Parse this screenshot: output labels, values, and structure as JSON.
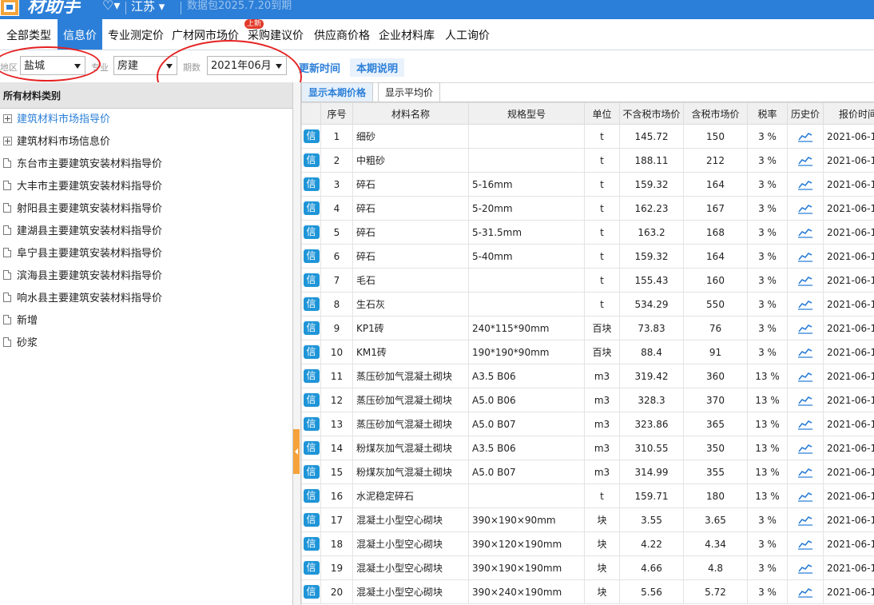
{
  "topbar": {
    "app_name": "材助手",
    "region": "江苏",
    "package_date": "数据包2025.7.20到期"
  },
  "nav": {
    "items": [
      "全部类型",
      "信息价",
      "专业测定价",
      "广材网市场价",
      "采购建议价",
      "供应商价格",
      "企业材料库",
      "人工询价"
    ],
    "active_index": 1,
    "new_badge": "上新"
  },
  "filters": {
    "area_label": "地区",
    "area_value": "盐城",
    "specialty_label": "专业",
    "specialty_value": "房建",
    "period_label": "期数",
    "period_value": "2021年06月",
    "update_time_link": "更新时间",
    "period_note_link": "本期说明"
  },
  "left_panel": {
    "header": "所有材料类别",
    "items": [
      {
        "label": "建筑材料市场指导价",
        "type": "plus",
        "highlight": true
      },
      {
        "label": "建筑材料市场信息价",
        "type": "plus",
        "highlight": false
      },
      {
        "label": "东台市主要建筑安装材料指导价",
        "type": "doc",
        "highlight": false
      },
      {
        "label": "大丰市主要建筑安装材料指导价",
        "type": "doc",
        "highlight": false
      },
      {
        "label": "射阳县主要建筑安装材料指导价",
        "type": "doc",
        "highlight": false
      },
      {
        "label": "建湖县主要建筑安装材料指导价",
        "type": "doc",
        "highlight": false
      },
      {
        "label": "阜宁县主要建筑安装材料指导价",
        "type": "doc",
        "highlight": false
      },
      {
        "label": "滨海县主要建筑安装材料指导价",
        "type": "doc",
        "highlight": false
      },
      {
        "label": "响水县主要建筑安装材料指导价",
        "type": "doc",
        "highlight": false
      },
      {
        "label": "新增",
        "type": "doc",
        "highlight": false
      },
      {
        "label": "砂浆",
        "type": "doc",
        "highlight": false
      }
    ]
  },
  "subtabs": [
    "显示本期价格",
    "显示平均价"
  ],
  "table": {
    "xin_label": "信",
    "headers": [
      "序号",
      "材料名称",
      "规格型号",
      "单位",
      "不含税市场价",
      "含税市场价",
      "税率",
      "历史价",
      "报价时间"
    ],
    "rows": [
      [
        "1",
        "细砂",
        "",
        "t",
        "145.72",
        "150",
        "3 %",
        "2021-06-1"
      ],
      [
        "2",
        "中粗砂",
        "",
        "t",
        "188.11",
        "212",
        "3 %",
        "2021-06-1"
      ],
      [
        "3",
        "碎石",
        "5-16mm",
        "t",
        "159.32",
        "164",
        "3 %",
        "2021-06-1"
      ],
      [
        "4",
        "碎石",
        "5-20mm",
        "t",
        "162.23",
        "167",
        "3 %",
        "2021-06-1"
      ],
      [
        "5",
        "碎石",
        "5-31.5mm",
        "t",
        "163.2",
        "168",
        "3 %",
        "2021-06-1"
      ],
      [
        "6",
        "碎石",
        "5-40mm",
        "t",
        "159.32",
        "164",
        "3 %",
        "2021-06-1"
      ],
      [
        "7",
        "毛石",
        "",
        "t",
        "155.43",
        "160",
        "3 %",
        "2021-06-1"
      ],
      [
        "8",
        "生石灰",
        "",
        "t",
        "534.29",
        "550",
        "3 %",
        "2021-06-1"
      ],
      [
        "9",
        "KP1砖",
        "240*115*90mm",
        "百块",
        "73.83",
        "76",
        "3 %",
        "2021-06-1"
      ],
      [
        "10",
        "KM1砖",
        "190*190*90mm",
        "百块",
        "88.4",
        "91",
        "3 %",
        "2021-06-1"
      ],
      [
        "11",
        "蒸压砂加气混凝土砌块",
        "A3.5 B06",
        "m3",
        "319.42",
        "360",
        "13 %",
        "2021-06-1"
      ],
      [
        "12",
        "蒸压砂加气混凝土砌块",
        "A5.0 B06",
        "m3",
        "328.3",
        "370",
        "13 %",
        "2021-06-1"
      ],
      [
        "13",
        "蒸压砂加气混凝土砌块",
        "A5.0 B07",
        "m3",
        "323.86",
        "365",
        "13 %",
        "2021-06-1"
      ],
      [
        "14",
        "粉煤灰加气混凝土砌块",
        "A3.5 B06",
        "m3",
        "310.55",
        "350",
        "13 %",
        "2021-06-1"
      ],
      [
        "15",
        "粉煤灰加气混凝土砌块",
        "A5.0 B07",
        "m3",
        "314.99",
        "355",
        "13 %",
        "2021-06-1"
      ],
      [
        "16",
        "水泥稳定碎石",
        "",
        "t",
        "159.71",
        "180",
        "13 %",
        "2021-06-1"
      ],
      [
        "17",
        "混凝土小型空心砌块",
        "390×190×90mm",
        "块",
        "3.55",
        "3.65",
        "3 %",
        "2021-06-1"
      ],
      [
        "18",
        "混凝土小型空心砌块",
        "390×120×190mm",
        "块",
        "4.22",
        "4.34",
        "3 %",
        "2021-06-1"
      ],
      [
        "19",
        "混凝土小型空心砌块",
        "390×190×190mm",
        "块",
        "4.66",
        "4.8",
        "3 %",
        "2021-06-1"
      ],
      [
        "20",
        "混凝土小型空心砌块",
        "390×240×190mm",
        "块",
        "5.56",
        "5.72",
        "3 %",
        "2021-06-1"
      ]
    ]
  }
}
